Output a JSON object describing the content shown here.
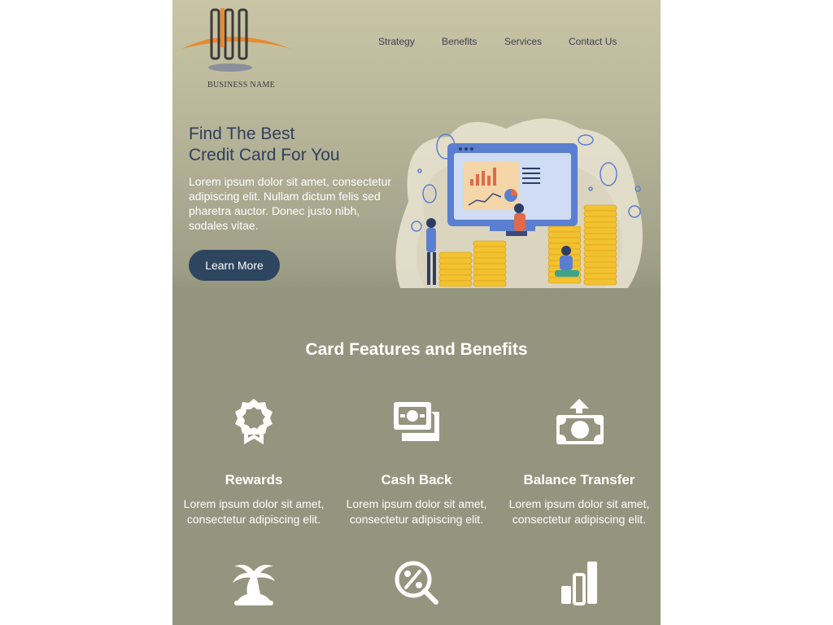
{
  "brand": {
    "name": "BUSINESS NAME"
  },
  "nav": {
    "items": [
      "Strategy",
      "Benefits",
      "Services",
      "Contact Us"
    ]
  },
  "hero": {
    "title_line1": "Find The Best",
    "title_line2": "Credit Card For You",
    "description": "Lorem ipsum dolor sit amet, consectetur adipiscing elit. Nullam dictum felis sed pharetra auctor. Donec justo nibh, sodales vitae.",
    "cta_label": "Learn More"
  },
  "features": {
    "title": "Card Features and Benefits",
    "items": [
      {
        "title": "Rewards",
        "text": "Lorem ipsum dolor sit amet, consectetur adipiscing elit.",
        "icon": "award-ribbon-icon"
      },
      {
        "title": "Cash Back",
        "text": "Lorem ipsum dolor sit amet, consectetur adipiscing elit.",
        "icon": "cash-icon"
      },
      {
        "title": "Balance Transfer",
        "text": "Lorem ipsum dolor sit amet, consectetur adipiscing elit.",
        "icon": "money-transfer-icon"
      },
      {
        "icon": "palm-tree-icon"
      },
      {
        "icon": "percent-search-icon"
      },
      {
        "icon": "bar-chart-icon"
      }
    ]
  },
  "colors": {
    "accent": "#2e4560",
    "logo_orange": "#e88b2e",
    "heading": "#2f3e5c",
    "background": "#94957e"
  }
}
